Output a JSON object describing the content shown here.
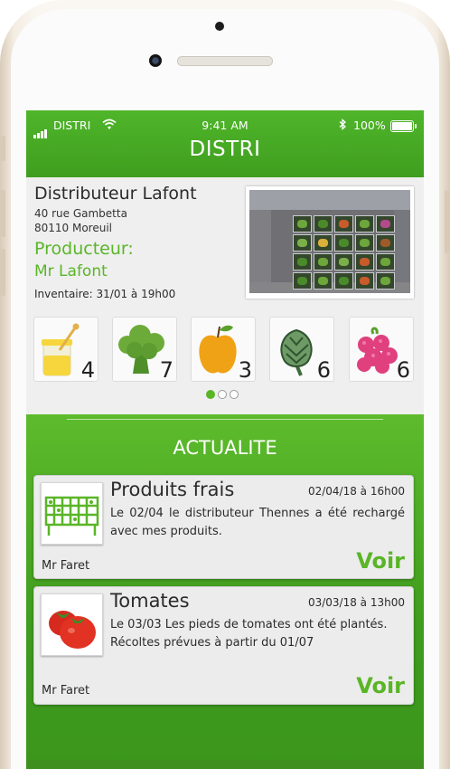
{
  "status_bar": {
    "carrier": "DISTRI",
    "time": "9:41 AM",
    "battery": "100%"
  },
  "header": {
    "title": "DISTRI"
  },
  "distributor": {
    "name": "Distributeur Lafont",
    "address_line1": "40 rue Gambetta",
    "address_line2": "80110 Moreuil",
    "producer_label": "Producteur:",
    "producer_name": "Mr Lafont",
    "inventory": "Inventaire: 31/01 à 19h00"
  },
  "products": [
    {
      "icon": "honey-jar-icon",
      "count": "4"
    },
    {
      "icon": "broccoli-icon",
      "count": "7"
    },
    {
      "icon": "apple-icon",
      "count": "3"
    },
    {
      "icon": "artichoke-icon",
      "count": "6"
    },
    {
      "icon": "raspberry-icon",
      "count": "6"
    }
  ],
  "carousel": {
    "pages": 3,
    "active": 0
  },
  "news": {
    "section_title": "ACTUALITE",
    "items": [
      {
        "icon": "vending-machine-icon",
        "title": "Produits frais",
        "date": "02/04/18 à 16h00",
        "text": "Le 02/04 le distributeur Thennes a été rechargé avec mes produits.",
        "author": "Mr Faret",
        "action": "Voir"
      },
      {
        "icon": "tomato-icon",
        "title": "Tomates",
        "date": "03/03/18 à 13h00",
        "text": "Le 03/03 Les pieds de tomates ont été plantés.",
        "text2": "Récoltes prévues à partir du 01/07",
        "author": "Mr Faret",
        "action": "Voir"
      }
    ]
  },
  "colors": {
    "brand_green": "#4fb52a",
    "accent_green": "#5ab527"
  }
}
